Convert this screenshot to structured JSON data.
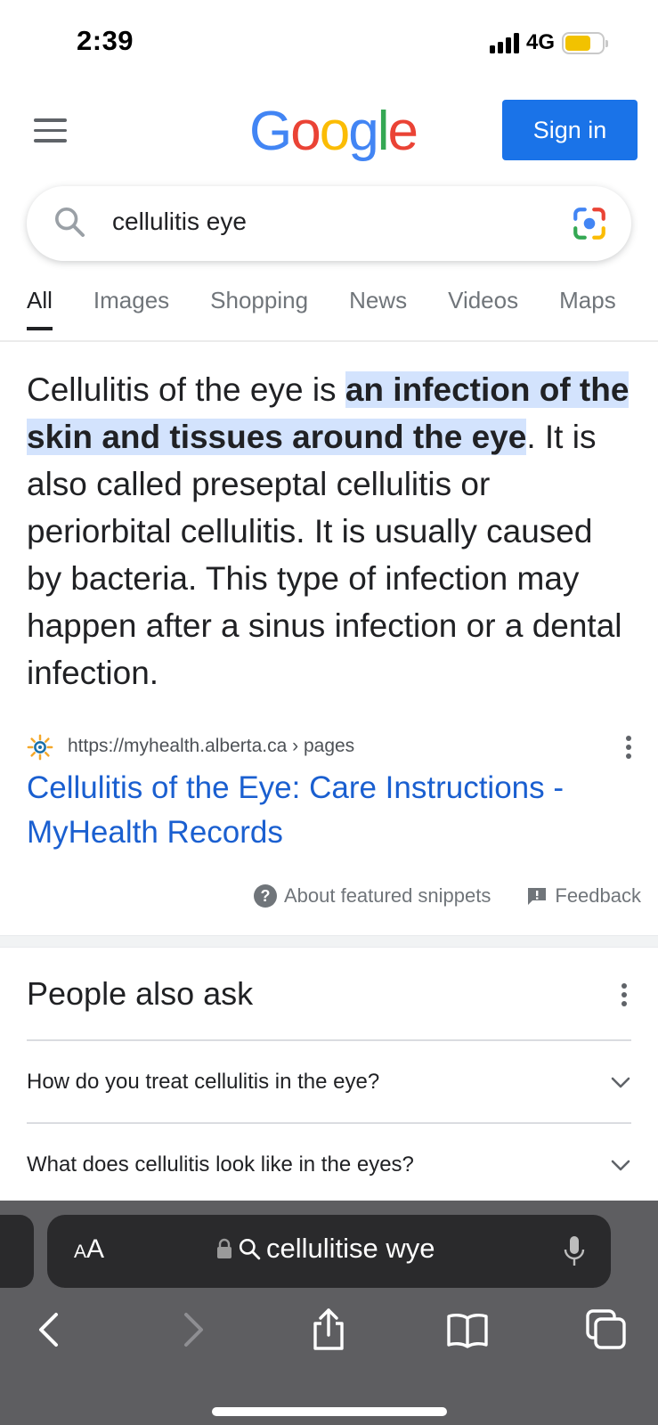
{
  "status_bar": {
    "time": "2:39",
    "network": "4G",
    "battery_level": 0.7
  },
  "header": {
    "logo_letters": [
      "G",
      "o",
      "o",
      "g",
      "l",
      "e"
    ],
    "logo_colors": [
      "#4285F4",
      "#EA4335",
      "#FBBC05",
      "#4285F4",
      "#34A853",
      "#EA4335"
    ],
    "signin_label": "Sign in",
    "menu_icon": "hamburger-menu-icon"
  },
  "search": {
    "query": "cellulitis eye",
    "search_icon": "search-icon",
    "lens_icon": "google-lens-icon"
  },
  "tabs": [
    {
      "label": "All",
      "active": true
    },
    {
      "label": "Images",
      "active": false
    },
    {
      "label": "Shopping",
      "active": false
    },
    {
      "label": "News",
      "active": false
    },
    {
      "label": "Videos",
      "active": false
    },
    {
      "label": "Maps",
      "active": false
    }
  ],
  "featured_snippet": {
    "text_before": "Cellulitis of the eye is ",
    "highlight": "an infection of the skin and tissues around the eye",
    "text_after": ". It is also called preseptal cellulitis or periorbital cellulitis. It is usually caused by bacteria. This type of infection may happen after a sinus infection or a dental infection.",
    "source_url": "https://myhealth.alberta.ca › pages",
    "result_title": "Cellulitis of the Eye: Care Instructions - MyHealth Records",
    "about_label": "About featured snippets",
    "feedback_label": "Feedback"
  },
  "people_also_ask": {
    "title": "People also ask",
    "questions": [
      "How do you treat cellulitis in the eye?",
      "What does cellulitis look like in the eyes?"
    ]
  },
  "safari": {
    "aa_label_big": "A",
    "aa_label_small": "A",
    "address_text": "cellulitise wye",
    "colors": {
      "toolbar": "#5e5e61",
      "address_bar": "#2a2a2c"
    }
  },
  "colors": {
    "accent": "#1a73e8",
    "link": "#1a5fd0",
    "highlight": "#d3e3fd"
  }
}
